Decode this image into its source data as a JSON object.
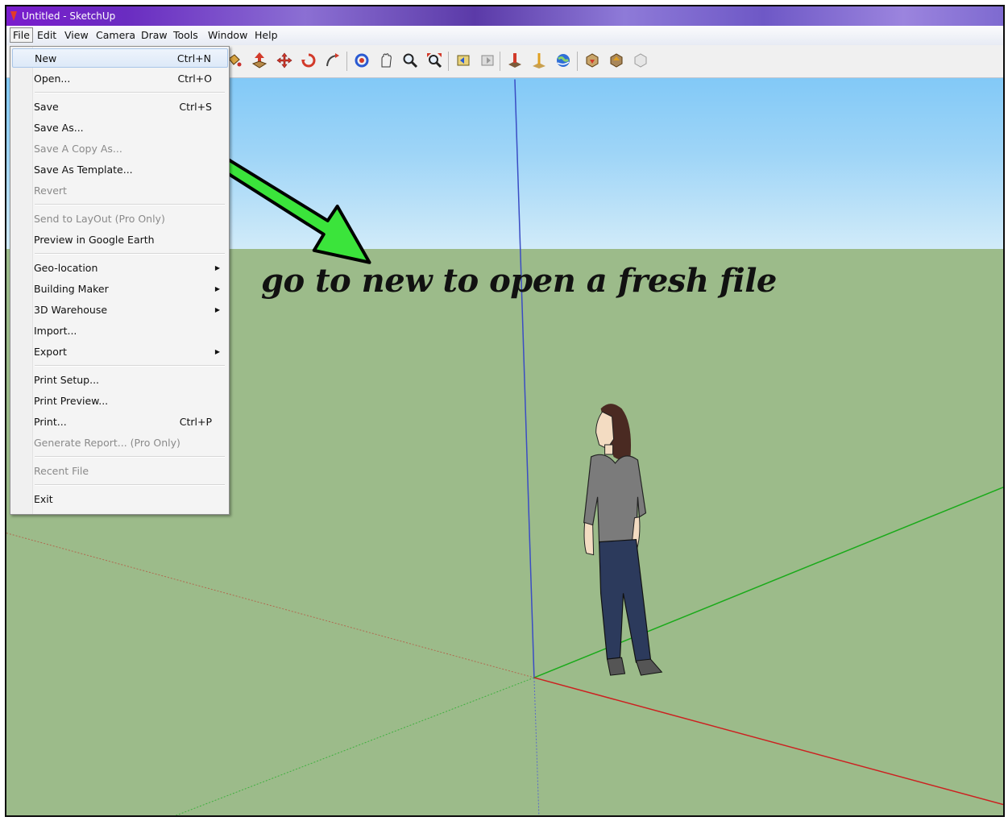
{
  "window": {
    "title": "Untitled - SketchUp"
  },
  "menubar": {
    "items": [
      {
        "label": "File"
      },
      {
        "label": "Edit"
      },
      {
        "label": "View"
      },
      {
        "label": "Camera"
      },
      {
        "label": "Draw"
      },
      {
        "label": "Tools"
      },
      {
        "label": "Window"
      },
      {
        "label": "Help"
      }
    ]
  },
  "file_menu": {
    "items": [
      {
        "label": "New",
        "shortcut": "Ctrl+N"
      },
      {
        "label": "Open...",
        "shortcut": "Ctrl+O"
      },
      {
        "label": "Save",
        "shortcut": "Ctrl+S"
      },
      {
        "label": "Save As...",
        "shortcut": ""
      },
      {
        "label": "Save A Copy As...",
        "shortcut": ""
      },
      {
        "label": "Save As Template...",
        "shortcut": ""
      },
      {
        "label": "Revert",
        "shortcut": ""
      },
      {
        "label": "Send to LayOut (Pro Only)",
        "shortcut": ""
      },
      {
        "label": "Preview in Google Earth",
        "shortcut": ""
      },
      {
        "label": "Geo-location",
        "shortcut": ""
      },
      {
        "label": "Building Maker",
        "shortcut": ""
      },
      {
        "label": "3D Warehouse",
        "shortcut": ""
      },
      {
        "label": "Import...",
        "shortcut": ""
      },
      {
        "label": "Export",
        "shortcut": ""
      },
      {
        "label": "Print Setup...",
        "shortcut": ""
      },
      {
        "label": "Print Preview...",
        "shortcut": ""
      },
      {
        "label": "Print...",
        "shortcut": "Ctrl+P"
      },
      {
        "label": "Generate Report... (Pro Only)",
        "shortcut": ""
      },
      {
        "label": "Recent File",
        "shortcut": ""
      },
      {
        "label": "Exit",
        "shortcut": ""
      }
    ],
    "highlighted_item": "New",
    "disabled_items": [
      "Save A Copy As...",
      "Revert",
      "Send to LayOut (Pro Only)",
      "Generate Report... (Pro Only)",
      "Recent File"
    ],
    "submenu_items": [
      "Geo-location",
      "Building Maker",
      "3D Warehouse",
      "Export"
    ]
  },
  "toolbar": {
    "icons": [
      "paint-bucket-icon",
      "push-pull-icon",
      "move-icon",
      "rotate-icon",
      "follow-me-icon",
      "orbit-icon",
      "pan-icon",
      "zoom-icon",
      "zoom-extents-icon",
      "previous-view-icon",
      "next-view-icon",
      "add-location-icon",
      "toggle-terrain-icon",
      "preview-google-earth-icon",
      "get-models-icon",
      "share-model-icon",
      "share-component-icon"
    ]
  },
  "annotation": {
    "text": "go to new to open a fresh file"
  },
  "colors": {
    "sky_top": "#82c9f7",
    "ground": "#9cbb8a",
    "axis_blue": "#3a4cc4",
    "axis_green": "#1aaa1a",
    "axis_red": "#cc2020",
    "arrow_green": "#3be43b"
  }
}
